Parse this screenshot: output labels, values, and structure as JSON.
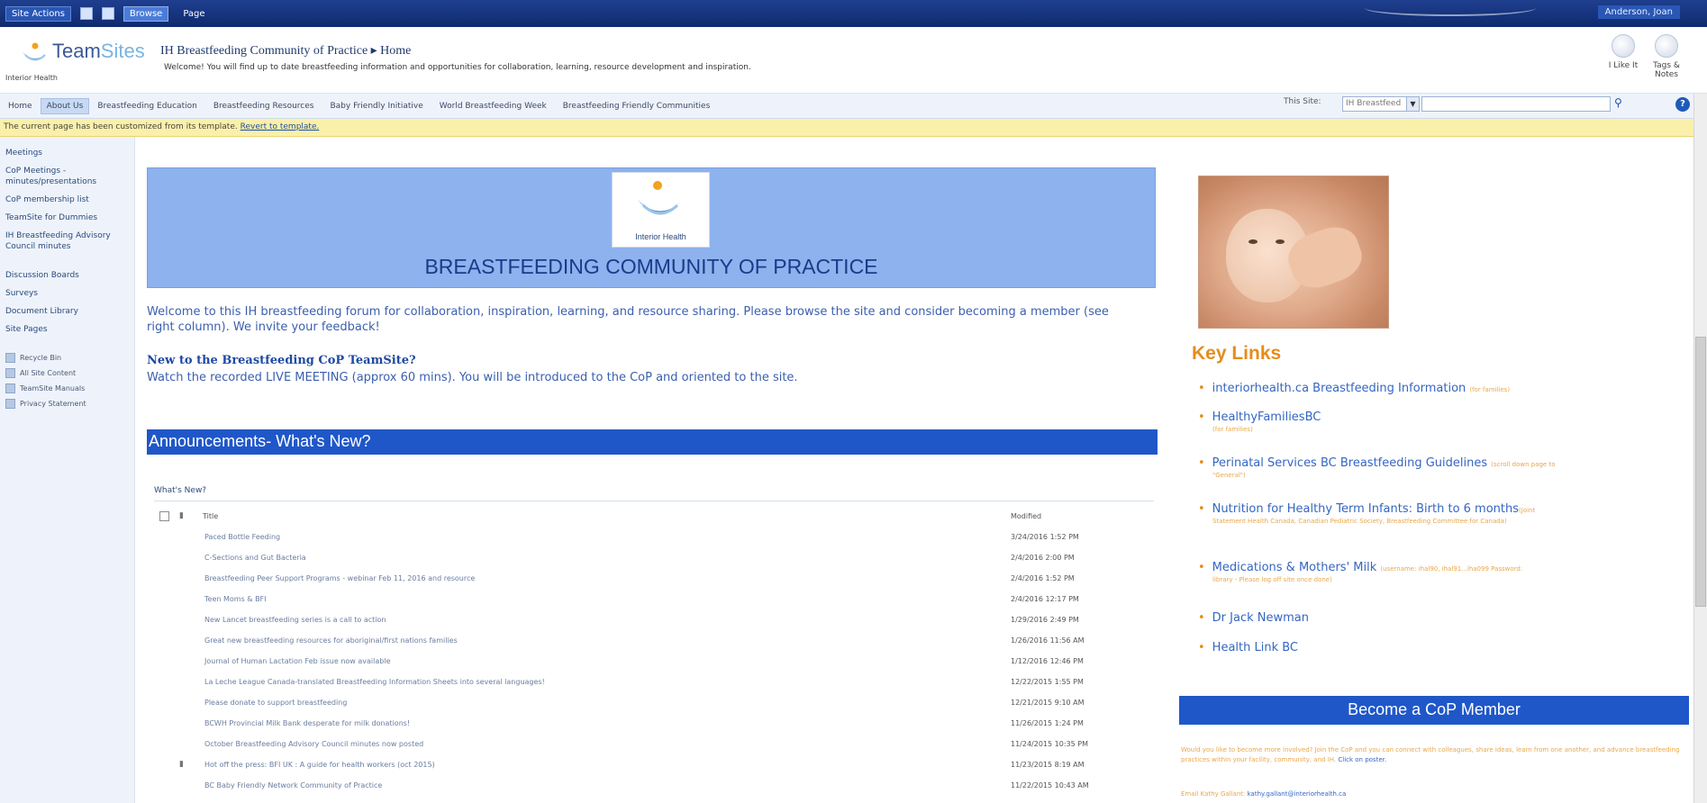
{
  "ribbon": {
    "site_actions": "Site Actions",
    "tabs": [
      "Browse",
      "Page"
    ],
    "user": "Anderson, Joan"
  },
  "header": {
    "brand_team": "Team",
    "brand_sites": "Sites",
    "org": "Interior Health",
    "breadcrumb": "IH Breastfeeding Community of Practice ▸ Home",
    "welcome": "Welcome! You will find up to date breastfeeding information and opportunities for collaboration, learning, resource development and inspiration.",
    "i_like_it": "I Like It",
    "tags_notes": "Tags & Notes"
  },
  "topnav": {
    "items": [
      "Home",
      "About Us",
      "Breastfeeding Education",
      "Breastfeeding Resources",
      "Baby Friendly Initiative",
      "World Breastfeeding Week",
      "Breastfeeding Friendly Communities"
    ],
    "selected_index": 1,
    "search_scope_label": "This Site:",
    "search_scope_value": "IH Breastfeed",
    "search_placeholder": ""
  },
  "status": {
    "message": "The current page has been customized from its template.",
    "link": "Revert to template."
  },
  "quicklaunch": {
    "group1": [
      "Meetings",
      "CoP Meetings - minutes/presentations",
      "CoP membership list",
      "TeamSite for Dummies",
      "IH Breastfeeding Advisory Council minutes"
    ],
    "group2": [
      "Discussion Boards",
      "Surveys",
      "Document Library",
      "Site Pages"
    ],
    "utilities": [
      {
        "label": "Recycle Bin",
        "icon": "recycle-bin-icon"
      },
      {
        "label": "All Site Content",
        "icon": "site-content-icon"
      },
      {
        "label": "TeamSite Manuals",
        "icon": "manual-icon"
      },
      {
        "label": "Privacy Statement",
        "icon": "privacy-icon"
      }
    ]
  },
  "main": {
    "logo_label": "Interior Health",
    "banner_title": "BREASTFEEDING COMMUNITY OF PRACTICE",
    "intro": "Welcome to this IH breastfeeding forum for collaboration, inspiration, learning, and resource sharing. Please browse the site and consider becoming a member (see right column). We invite your feedback!",
    "new_heading": "New to the Breastfeeding CoP TeamSite?",
    "new_body": "Watch the recorded LIVE MEETING (approx 60 mins). You will be introduced to the CoP and oriented to the site.",
    "announcements_title": "Announcements- What's New?",
    "whats_new_label": "What's New?",
    "columns": {
      "title": "Title",
      "modified": "Modified"
    },
    "announcements": [
      {
        "title": "Paced Bottle Feeding",
        "modified": "3/24/2016 1:52 PM"
      },
      {
        "title": "C-Sections and Gut Bacteria",
        "modified": "2/4/2016 2:00 PM"
      },
      {
        "title": "Breastfeeding Peer Support Programs - webinar Feb 11, 2016 and resource",
        "modified": "2/4/2016 1:52 PM"
      },
      {
        "title": "Teen Moms & BFI",
        "modified": "2/4/2016 12:17 PM"
      },
      {
        "title": "New Lancet breastfeeding series is a call to action",
        "modified": "1/29/2016 2:49 PM"
      },
      {
        "title": "Great new breastfeeding resources for aboriginal/first nations families",
        "modified": "1/26/2016 11:56 AM"
      },
      {
        "title": "Journal of Human Lactation Feb issue now available",
        "modified": "1/12/2016 12:46 PM"
      },
      {
        "title": "La Leche League Canada-translated Breastfeeding Information Sheets into several languages!",
        "modified": "12/22/2015 1:55 PM"
      },
      {
        "title": "Please donate to support breastfeeding",
        "modified": "12/21/2015 9:10 AM"
      },
      {
        "title": "BCWH Provincial Milk Bank desperate for milk donations!",
        "modified": "11/26/2015 1:24 PM"
      },
      {
        "title": "October Breastfeeding Advisory Council minutes now posted",
        "modified": "11/24/2015 10:35 PM"
      },
      {
        "title": "Hot off the press: BFI UK : A guide for health workers (oct 2015)",
        "modified": "11/23/2015 8:19 AM"
      },
      {
        "title": "BC Baby Friendly Network Community of Practice",
        "modified": "11/22/2015 10:43 AM"
      }
    ]
  },
  "right": {
    "key_links_title": "Key Links",
    "links": [
      {
        "label": "interiorhealth.ca Breastfeeding Information",
        "note": "(for families)",
        "sub": ""
      },
      {
        "label": "HealthyFamiliesBC",
        "note": "",
        "sub": "(for families)"
      },
      {
        "label": "Perinatal Services BC Breastfeeding Guidelines",
        "note": "(scroll down page to",
        "sub": "\"General\")"
      },
      {
        "label": "Nutrition for Healthy Term Infants: Birth to 6 months",
        "note": "(Joint",
        "sub": "Statement Health Canada, Canadian Pediatric Society, Breastfeeding Committee for Canada)"
      },
      {
        "label": "Medications & Mothers' Milk",
        "note": "(username: ihal90, ihal91...iha099 Password:",
        "sub": "library - Please log off site once done)"
      },
      {
        "label": "Dr Jack Newman",
        "note": "",
        "sub": ""
      },
      {
        "label": "Health Link BC",
        "note": "",
        "sub": ""
      }
    ],
    "cop_title": "Become a CoP Member",
    "cop_text": "Would you like to become more involved? Join the CoP and you can connect with colleagues, share ideas, learn from one another, and advance breastfeeding practices within your facility, community, and IH.",
    "cop_click": "Click on poster.",
    "cop_email_label": "Email Kathy Gallant:",
    "cop_email": "kathy.gallant@interiorhealth.ca"
  },
  "colors": {
    "ribbon": "#0f2a6e",
    "banner": "#8db2ee",
    "accent_blue": "#1f57c9",
    "key_links_orange": "#e58d1a",
    "status_yellow": "#fbf0a9"
  }
}
